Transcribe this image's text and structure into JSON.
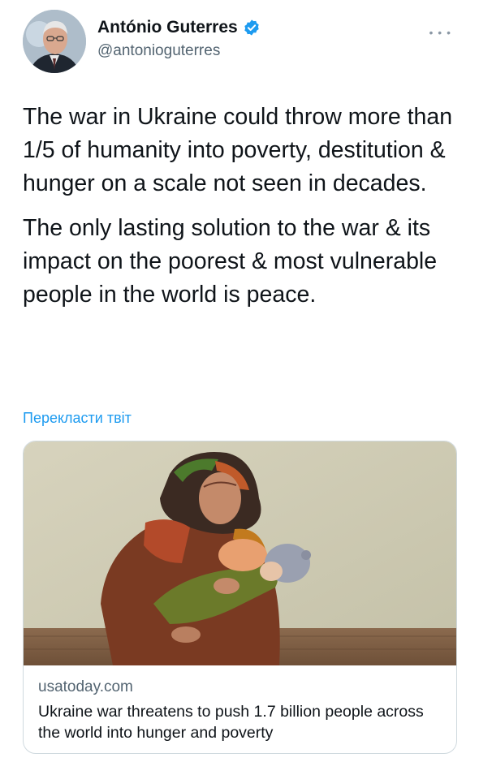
{
  "author": {
    "display_name": "António Guterres",
    "handle": "@antonioguterres",
    "verified_icon": "verified-badge-icon",
    "avatar_icon": "avatar"
  },
  "more_icon": "more-options-icon",
  "tweet": {
    "paragraph_1": "The war in Ukraine could throw more than 1/5 of humanity into poverty, destitution & hunger on a scale not seen in decades.",
    "paragraph_2": "The only lasting solution to the war & its impact on the poorest & most vulnerable people in the world is peace."
  },
  "translate_label": "Перекласти твіт",
  "card": {
    "domain": "usatoday.com",
    "title": "Ukraine war threatens to push 1.7 billion people across the world into hunger and poverty",
    "image_icon": "article-photo"
  },
  "colors": {
    "link": "#1d9bf0",
    "secondary_text": "#536471",
    "border": "#cfd9de",
    "verified": "#1d9bf0"
  }
}
